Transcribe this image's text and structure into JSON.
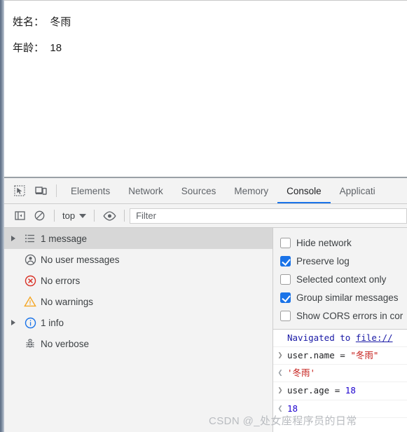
{
  "page": {
    "lines": [
      {
        "label": "姓名：",
        "value": "冬雨"
      },
      {
        "label": "年龄：",
        "value": "18"
      }
    ]
  },
  "devtools": {
    "toolbar_icons": [
      {
        "name": "inspect-element-icon",
        "label": "inspect"
      },
      {
        "name": "device-toolbar-icon",
        "label": "device-toolbar"
      }
    ],
    "tabs": [
      {
        "label": "Elements",
        "active": false
      },
      {
        "label": "Network",
        "active": false
      },
      {
        "label": "Sources",
        "active": false
      },
      {
        "label": "Memory",
        "active": false
      },
      {
        "label": "Console",
        "active": true
      },
      {
        "label": "Applicati",
        "active": false
      }
    ],
    "console_toolbar": {
      "sidebar_toggle_label": "sidebar-toggle",
      "clear_console_label": "clear-console",
      "context_value": "top",
      "eye_label": "live-expression",
      "filter_placeholder": "Filter",
      "filter_value": ""
    },
    "sidebar": {
      "items": [
        {
          "label": "1 message",
          "icon": "list-icon",
          "arrow": true,
          "selected": true
        },
        {
          "label": "No user messages",
          "icon": "person-icon",
          "arrow": false,
          "selected": false
        },
        {
          "label": "No errors",
          "icon": "error-icon",
          "arrow": false,
          "selected": false
        },
        {
          "label": "No warnings",
          "icon": "warning-icon",
          "arrow": false,
          "selected": false
        },
        {
          "label": "1 info",
          "icon": "info-icon",
          "arrow": true,
          "selected": false
        },
        {
          "label": "No verbose",
          "icon": "bug-icon",
          "arrow": false,
          "selected": false
        }
      ]
    },
    "settings": {
      "options": [
        {
          "label": "Hide network",
          "checked": false
        },
        {
          "label": "Preserve log",
          "checked": true
        },
        {
          "label": "Selected context only",
          "checked": false
        },
        {
          "label": "Group similar messages",
          "checked": true
        },
        {
          "label": "Show CORS errors in cor",
          "checked": false
        }
      ]
    },
    "messages": [
      {
        "gutter": "",
        "kind": "navigated",
        "parts": [
          {
            "text": "Navigated to ",
            "style": "blue"
          },
          {
            "text": "file://",
            "style": "link"
          }
        ]
      },
      {
        "gutter": "❯",
        "kind": "input",
        "parts": [
          {
            "text": "user.name = ",
            "style": "dark"
          },
          {
            "text": "\"冬雨\"",
            "style": "string"
          }
        ]
      },
      {
        "gutter": "❮",
        "kind": "output",
        "parts": [
          {
            "text": "'冬雨'",
            "style": "string"
          }
        ]
      },
      {
        "gutter": "❯",
        "kind": "input",
        "parts": [
          {
            "text": "user.age = ",
            "style": "dark"
          },
          {
            "text": "18",
            "style": "number"
          }
        ]
      },
      {
        "gutter": "❮",
        "kind": "output",
        "parts": [
          {
            "text": "18",
            "style": "number"
          }
        ]
      }
    ]
  },
  "watermark": {
    "text": "CSDN @_处女座程序员的日常"
  },
  "colors": {
    "accent": "#1a73e8",
    "panel_bg": "#f3f3f3",
    "selected_row": "#d7d7d7",
    "error_red": "#d93025",
    "warning_orange": "#f5a623",
    "info_blue": "#1a73e8",
    "string_red": "#c41a16",
    "number_blue": "#1c00cf",
    "link_blue": "#1a1aa6"
  }
}
